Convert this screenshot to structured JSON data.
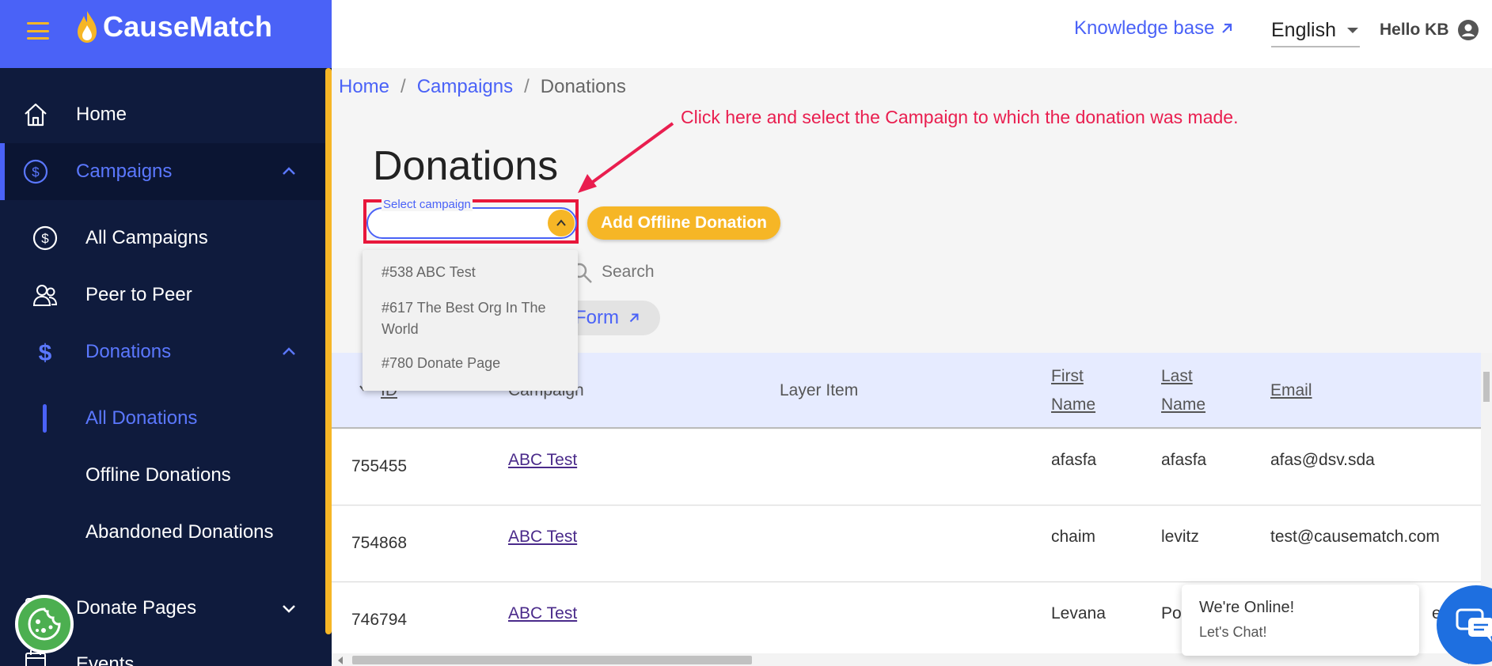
{
  "brand": {
    "name": "CauseMatch"
  },
  "header": {
    "knowledge_base": "Knowledge base",
    "language": "English",
    "greeting": "Hello KB"
  },
  "sidebar": {
    "items": [
      {
        "label": "Home"
      },
      {
        "label": "Campaigns"
      },
      {
        "label": "All Campaigns"
      },
      {
        "label": "Peer to Peer"
      },
      {
        "label": "Donations"
      },
      {
        "label": "All Donations"
      },
      {
        "label": "Offline Donations"
      },
      {
        "label": "Abandoned Donations"
      },
      {
        "label": "Donate Pages"
      },
      {
        "label": "Events"
      }
    ]
  },
  "breadcrumb": {
    "home": "Home",
    "campaigns": "Campaigns",
    "current": "Donations",
    "separator": "/"
  },
  "annotation": {
    "text": "Click here and select the Campaign to which the donation was made."
  },
  "page": {
    "title": "Donations"
  },
  "campaign_select": {
    "label": "Select campaign",
    "options": [
      "#538 ABC Test",
      "#617 The Best Org In The World",
      "#780 Donate Page"
    ]
  },
  "actions": {
    "add_offline": "Add Offline Donation",
    "form_link": "Form"
  },
  "search": {
    "placeholder": "Search"
  },
  "table": {
    "headers": {
      "id": "ID",
      "campaign": "Campaign",
      "layer_item": "Layer Item",
      "first_name_1": "First",
      "first_name_2": "Name",
      "last_name_1": "Last",
      "last_name_2": "Name",
      "email": "Email"
    },
    "rows": [
      {
        "id": "755455",
        "campaign": "ABC Test",
        "first": "afasfa",
        "last": "afasfa",
        "email": "afas@dsv.sda"
      },
      {
        "id": "754868",
        "campaign": "ABC Test",
        "first": "chaim",
        "last": "levitz",
        "email": "test@causematch.com"
      },
      {
        "id": "746794",
        "campaign": "ABC Test",
        "first": "Levana",
        "last": "Po",
        "email": "ess"
      }
    ]
  },
  "chat": {
    "title": "We're Online!",
    "subtitle": "Let's Chat!"
  },
  "colors": {
    "brand_blue": "#4a62f7",
    "sidebar": "#0f1b3d",
    "accent": "#f6b626",
    "annotation": "#e91e4f"
  }
}
